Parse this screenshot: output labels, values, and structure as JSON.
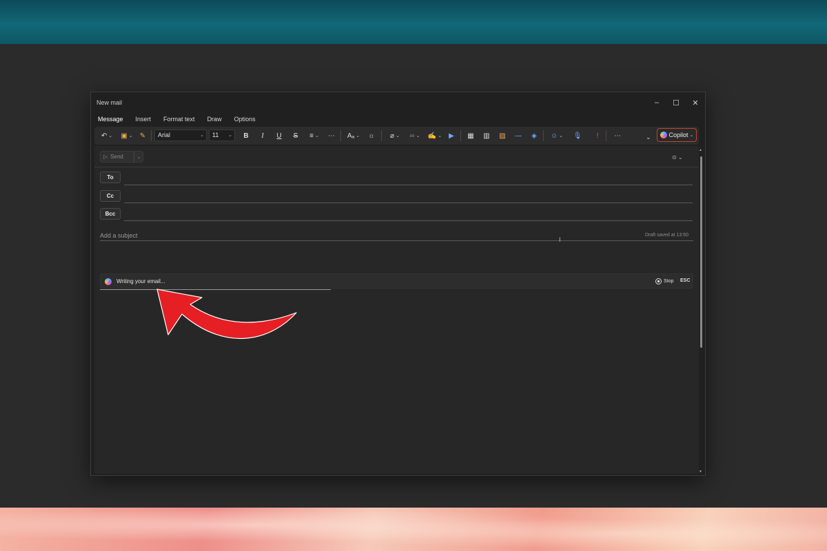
{
  "window": {
    "title": "New mail"
  },
  "tabs": [
    "Message",
    "Insert",
    "Format text",
    "Draw",
    "Options"
  ],
  "ribbon": {
    "font_name": "Arial",
    "font_size": "11",
    "copilot_label": "Copilot"
  },
  "compose": {
    "send_label": "Send",
    "to_label": "To",
    "cc_label": "Cc",
    "bcc_label": "Bcc",
    "subject_placeholder": "Add a subject",
    "draft_status": "Draft saved at 13:50"
  },
  "copilot_bar": {
    "status_text": "Writing your email...",
    "stop_label": "Stop",
    "esc_label": "ESC"
  },
  "colors": {
    "accent": "#7fb2ff",
    "copilot_border": "#b9482a",
    "annotation_arrow": "#e51f24"
  }
}
